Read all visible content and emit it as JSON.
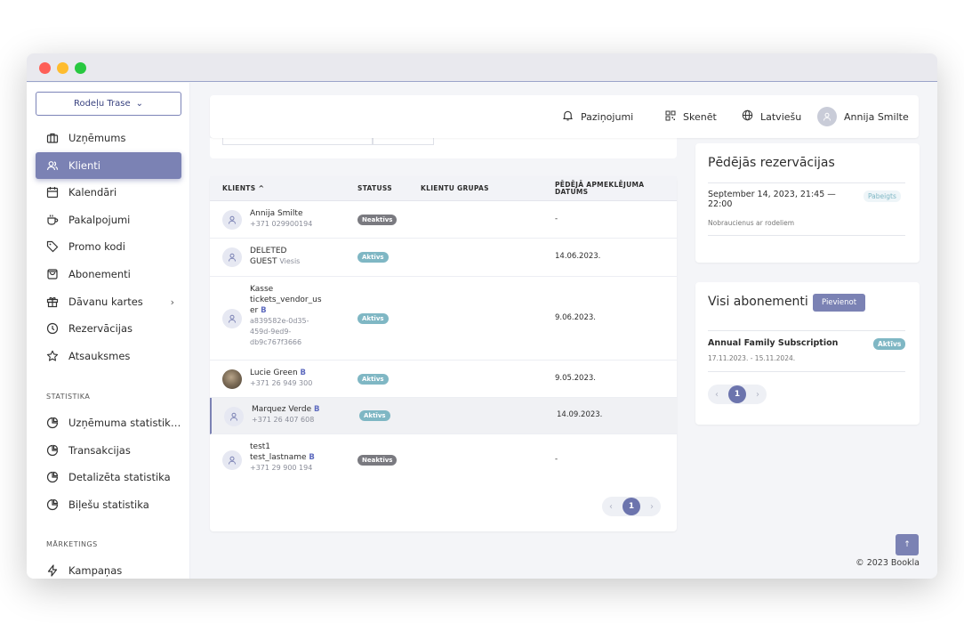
{
  "sidebar": {
    "venue": "Rodeļu Trase",
    "items": [
      {
        "label": "Uzņēmums",
        "icon": "briefcase-icon"
      },
      {
        "label": "Klienti",
        "icon": "users-icon",
        "active": true
      },
      {
        "label": "Kalendāri",
        "icon": "calendar-icon"
      },
      {
        "label": "Pakalpojumi",
        "icon": "cup-icon"
      },
      {
        "label": "Promo kodi",
        "icon": "tag-icon"
      },
      {
        "label": "Abonementi",
        "icon": "bag-icon"
      },
      {
        "label": "Dāvanu kartes",
        "icon": "gift-icon"
      },
      {
        "label": "Rezervācijas",
        "icon": "clock-icon"
      },
      {
        "label": "Atsauksmes",
        "icon": "star-icon"
      }
    ],
    "section_stats": "STATISTIKA",
    "stats_items": [
      {
        "label": "Uzņēmuma statistik…",
        "icon": "pie-chart-icon"
      },
      {
        "label": "Transakcijas",
        "icon": "pie-chart-icon"
      },
      {
        "label": "Detalizēta statistika",
        "icon": "pie-chart-icon"
      },
      {
        "label": "Biļešu statistika",
        "icon": "pie-chart-icon"
      }
    ],
    "section_marketing": "MĀRKETINGS",
    "marketing_items": [
      {
        "label": "Kampaņas",
        "icon": "bolt-icon"
      }
    ]
  },
  "header": {
    "notifications": "Paziņojumi",
    "scan": "Skenēt",
    "language": "Latviešu",
    "user": "Annija Smilte"
  },
  "clients_table": {
    "columns": [
      "KLIENTS",
      "STATUSS",
      "KLIENTU GRUPAS",
      "PĒDĒJĀ APMEKLĒJUMA",
      "DATUMS"
    ],
    "rows": [
      {
        "line1": "Annija Smilte",
        "line2": "",
        "mark": "",
        "sub": "+371 029900194",
        "status": "Neaktīvs",
        "date": "-"
      },
      {
        "line1": "DELETED",
        "line2": "GUEST",
        "mark": "",
        "sub": "Viesis",
        "status": "Aktīvs",
        "date": "14.06.2023."
      },
      {
        "line1": "Kasse",
        "line2": "tickets_vendor_us",
        "line3": "er",
        "mark": "B",
        "sub1": "a839582e-0d35-",
        "sub2": "459d-9ed9-",
        "sub3": "db9c767f3666",
        "status": "Aktīvs",
        "date": "9.06.2023."
      },
      {
        "line1": "Lucie Green",
        "line2": "",
        "mark": "B",
        "sub": "+371 26 949 300",
        "status": "Aktīvs",
        "date": "9.05.2023."
      },
      {
        "line1": "Marquez Verde",
        "line2": "",
        "mark": "B",
        "sub": "+371 26 407 608",
        "status": "Aktīvs",
        "date": "14.09.2023."
      },
      {
        "line1": "test1",
        "line2": "test_lastname",
        "mark": "B",
        "sub": "+371 29 900 194",
        "status": "Neaktīvs",
        "date": "-"
      }
    ],
    "page": "1"
  },
  "reservations": {
    "title": "Pēdējās rezervācijas",
    "item_time1": "September 14, 2023, 21:45 —",
    "item_time2": "22:00",
    "item_status": "Pabeigts",
    "item_desc": "Nobraucienus ar rodeliem"
  },
  "subscriptions": {
    "title": "Visi abonementi",
    "add_label": "Pievienot",
    "item_name": "Annual Family Subscription",
    "item_status": "Aktīvs",
    "item_dates": "17.11.2023. - 15.11.2024.",
    "page": "1"
  },
  "footer": "© 2023 Bookla",
  "arrows": {
    "prev": "‹",
    "next": "›",
    "up": "↑",
    "sort_up": "^",
    "dropdown": "⌄",
    "submenu": "›"
  }
}
